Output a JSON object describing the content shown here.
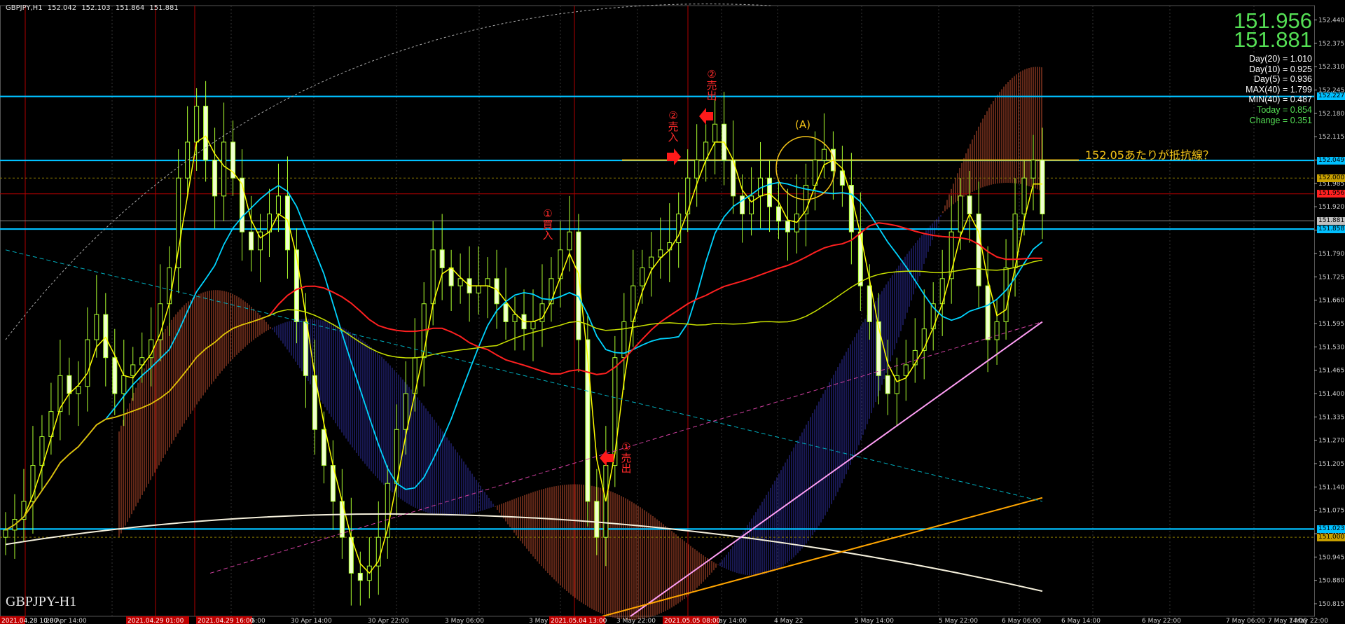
{
  "header": {
    "symbol_tf": "GBPJPY,H1",
    "ohlc": [
      "152.042",
      "152.103",
      "151.864",
      "151.881"
    ]
  },
  "quote": {
    "bid": "151.956",
    "ask": "151.881"
  },
  "stats": [
    {
      "text": "Day(20) = 1.010",
      "color": "#ffffff"
    },
    {
      "text": "Day(10) = 0.925",
      "color": "#ffffff"
    },
    {
      "text": "Day(5) = 0.936",
      "color": "#ffffff"
    },
    {
      "text": "MAX(40) = 1.799",
      "color": "#ffffff"
    },
    {
      "text": "MIN(40) = 0.487",
      "color": "#ffffff"
    },
    {
      "text": "Today = 0.854",
      "color": "#55e055"
    },
    {
      "text": "Change = 0.351",
      "color": "#55e055"
    }
  ],
  "symbol_label": "GBPJPY-H1",
  "annotations": {
    "buy1": "①買入",
    "sell1": "①売出",
    "buy2": "②売入",
    "sell2": "②売出",
    "circle_label": "(A)",
    "resistance_note": "152.05あたりが抵抗線？"
  },
  "colors": {
    "candle": "#adff2f",
    "hline": "#00c0ff",
    "ema_red": "#ff2020",
    "ema_yellow": "#ffff00",
    "ema_cyan": "#00d4ff",
    "sma_long": "#ffffff",
    "sma_pink": "#ff9ef5",
    "orange": "#ffa500",
    "ichimoku_blue": "#3030a0",
    "ichimoku_red": "#c05030",
    "annotation_red": "#ff2a2a"
  },
  "chart_data": {
    "type": "candlestick",
    "symbol": "GBPJPY",
    "timeframe": "H1",
    "ylim": [
      150.78,
      152.48
    ],
    "y_ticks": [
      "152.440",
      "152.375",
      "152.310",
      "152.245",
      "152.180",
      "152.115",
      "152.050",
      "151.985",
      "151.920",
      "151.855",
      "151.790",
      "151.725",
      "151.660",
      "151.595",
      "151.530",
      "151.465",
      "151.400",
      "151.335",
      "151.270",
      "151.205",
      "151.140",
      "151.075",
      "151.010",
      "150.945",
      "150.880",
      "150.815"
    ],
    "x_ticks": [
      "28 Apr 14:00",
      "29 Apr 22:00",
      "30 Apr 06:00",
      "30 Apr 14:00",
      "30 Apr 22:00",
      "3 May 06:00",
      "3 May 14:00",
      "3 May 22:00",
      "4 May 14:00",
      "4 May 22",
      "5 May 14:00",
      "5 May 22:00",
      "6 May 06:00",
      "6 May 14:00",
      "6 May 22:00",
      "7 May 06:00",
      "7 May 14:00",
      "7 May 22:00"
    ],
    "x_tick_highlights": [
      "2021.04.28 10:00",
      "2021.04.29 01:00",
      "2021.04.29 16:00",
      "2021.05.04 13:00",
      "2021.05.05 08:00"
    ],
    "right_axis_tags": [
      {
        "label": "152.227",
        "value": 152.227,
        "color": "#00c0ff"
      },
      {
        "label": "152.049",
        "value": 152.049,
        "color": "#00c0ff"
      },
      {
        "label": "152.000",
        "value": 152.0,
        "color": "#c8a000"
      },
      {
        "label": "151.956",
        "value": 151.956,
        "color": "#ff2020"
      },
      {
        "label": "151.881",
        "value": 151.881,
        "color": "#c0c0c0"
      },
      {
        "label": "151.858",
        "value": 151.858,
        "color": "#00c0ff"
      },
      {
        "label": "151.023",
        "value": 151.023,
        "color": "#00c0ff"
      },
      {
        "label": "151.000",
        "value": 151.0,
        "color": "#c8a000"
      }
    ],
    "horizontal_levels": [
      152.227,
      152.049,
      151.858,
      151.023
    ],
    "resistance_level": 152.05,
    "closes": [
      151.02,
      151.05,
      151.1,
      151.2,
      151.28,
      151.35,
      151.45,
      151.4,
      151.42,
      151.55,
      151.62,
      151.5,
      151.4,
      151.45,
      151.48,
      151.5,
      151.55,
      151.65,
      151.75,
      152.0,
      152.1,
      152.2,
      152.05,
      151.95,
      152.1,
      152.0,
      151.85,
      151.8,
      151.85,
      151.9,
      151.95,
      151.8,
      151.6,
      151.45,
      151.3,
      151.2,
      151.1,
      151.0,
      150.9,
      150.88,
      150.92,
      151.0,
      151.15,
      151.3,
      151.4,
      151.5,
      151.65,
      151.8,
      151.75,
      151.7,
      151.72,
      151.68,
      151.7,
      151.72,
      151.65,
      151.6,
      151.62,
      151.58,
      151.6,
      151.65,
      151.72,
      151.8,
      151.85,
      151.55,
      151.1,
      151.0,
      151.2,
      151.5,
      151.6,
      151.7,
      151.75,
      151.78,
      151.8,
      151.82,
      151.9,
      152.0,
      152.05,
      152.1,
      152.15,
      152.05,
      151.95,
      151.9,
      151.95,
      152.0,
      151.92,
      151.88,
      151.85,
      151.9,
      151.98,
      152.05,
      152.08,
      152.02,
      151.98,
      151.85,
      151.7,
      151.6,
      151.45,
      151.4,
      151.45,
      151.48,
      151.52,
      151.58,
      151.65,
      151.72,
      151.85,
      151.95,
      151.9,
      151.7,
      151.55,
      151.6,
      151.75,
      151.9,
      152.0,
      152.05,
      151.9
    ]
  }
}
